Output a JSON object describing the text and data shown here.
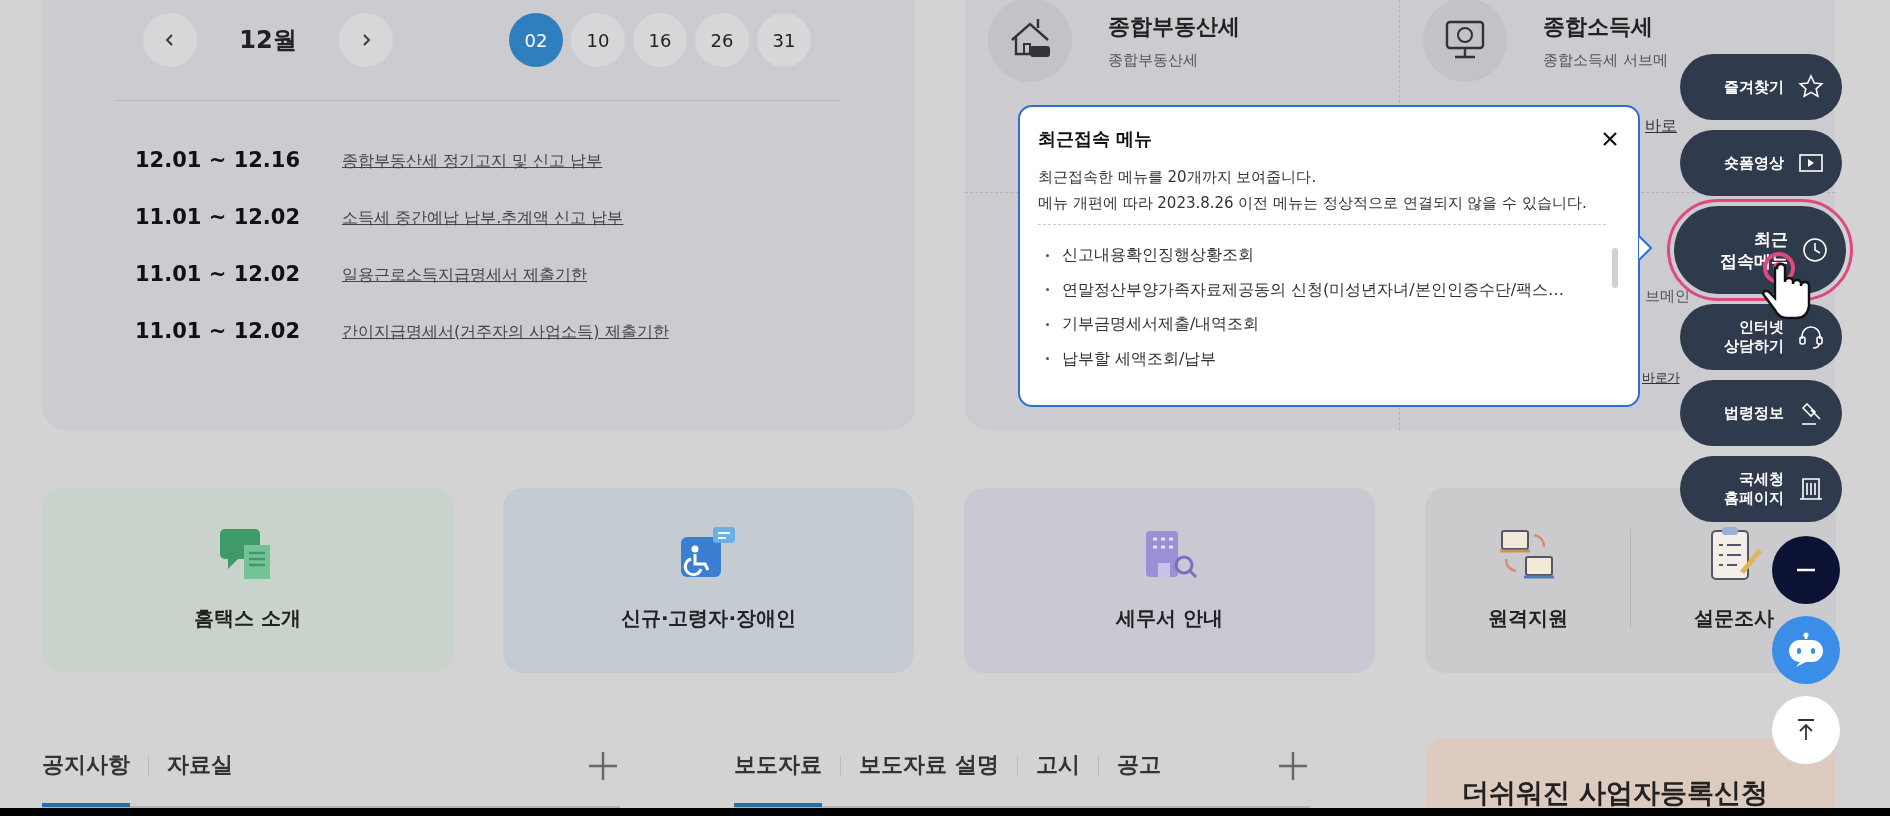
{
  "calendar": {
    "month": "12월",
    "dates": [
      {
        "label": "02",
        "selected": true
      },
      {
        "label": "10",
        "selected": false
      },
      {
        "label": "16",
        "selected": false
      },
      {
        "label": "26",
        "selected": false
      },
      {
        "label": "31",
        "selected": false
      }
    ],
    "schedule": [
      {
        "period": "12.01 ~ 12.16",
        "title": "종합부동산세 정기고지 및 신고 납부"
      },
      {
        "period": "11.01 ~ 12.02",
        "title": "소득세 중간예납 납부.추계액 신고 납부"
      },
      {
        "period": "11.01 ~ 12.02",
        "title": "일용근로소득지급명세서 제출기한"
      },
      {
        "period": "11.01 ~ 12.02",
        "title": "간이지급명세서(거주자의 사업소득) 제출기한"
      }
    ]
  },
  "services": [
    {
      "title": "종합부동산세",
      "subtitle": "종합부동산세"
    },
    {
      "title": "종합소득세",
      "subtitle": "종합소득세 서브메",
      "link": "바로"
    },
    {
      "subtitle": "브메인",
      "link": "바로가"
    }
  ],
  "recent_popup": {
    "title": "최근접속 메뉴",
    "description": [
      "최근접속한 메뉴를 20개까지 보여줍니다.",
      "메뉴 개편에 따라 2023.8.26 이전 메뉴는 정상적으로 연결되지 않을 수 있습니다."
    ],
    "items": [
      "신고내용확인징행상황조회",
      "연말정산부양가족자료제공동의 신청(미성년자녀/본인인증수단/팩스…",
      "기부금명세서제출/내역조회",
      "납부할 세액조회/납부"
    ]
  },
  "quick_links": [
    {
      "color": "#c9d3cb",
      "items": [
        "홈택스 소개"
      ]
    },
    {
      "color": "#c4cbd3",
      "items": [
        "신규·고령자·장애인"
      ]
    },
    {
      "color": "#cac9d3",
      "items": [
        "세무서 안내"
      ]
    },
    {
      "color": "#cbcbcd",
      "items": [
        "원격지원",
        "설문조사"
      ]
    }
  ],
  "float_menu": [
    {
      "lines": [
        "즐겨찾기"
      ],
      "selected": false
    },
    {
      "lines": [
        "숏폼영상"
      ],
      "selected": false
    },
    {
      "lines": [
        "최근",
        "접속메뉴"
      ],
      "selected": true
    },
    {
      "lines": [
        "인터넷",
        "상담하기"
      ],
      "selected": false
    },
    {
      "lines": [
        "법령정보"
      ],
      "selected": false
    },
    {
      "lines": [
        "국세청",
        "홈페이지"
      ],
      "selected": false
    }
  ],
  "board_tabs": [
    [
      {
        "label": "공지사항",
        "selected": true
      },
      {
        "label": "자료실",
        "selected": false
      }
    ],
    [
      {
        "label": "보도자료",
        "selected": true
      },
      {
        "label": "보도자료 설명",
        "selected": false
      },
      {
        "label": "고시",
        "selected": false
      },
      {
        "label": "공고",
        "selected": false
      }
    ]
  ],
  "banner": {
    "title": "더쉬워진 사업자등록신청"
  }
}
